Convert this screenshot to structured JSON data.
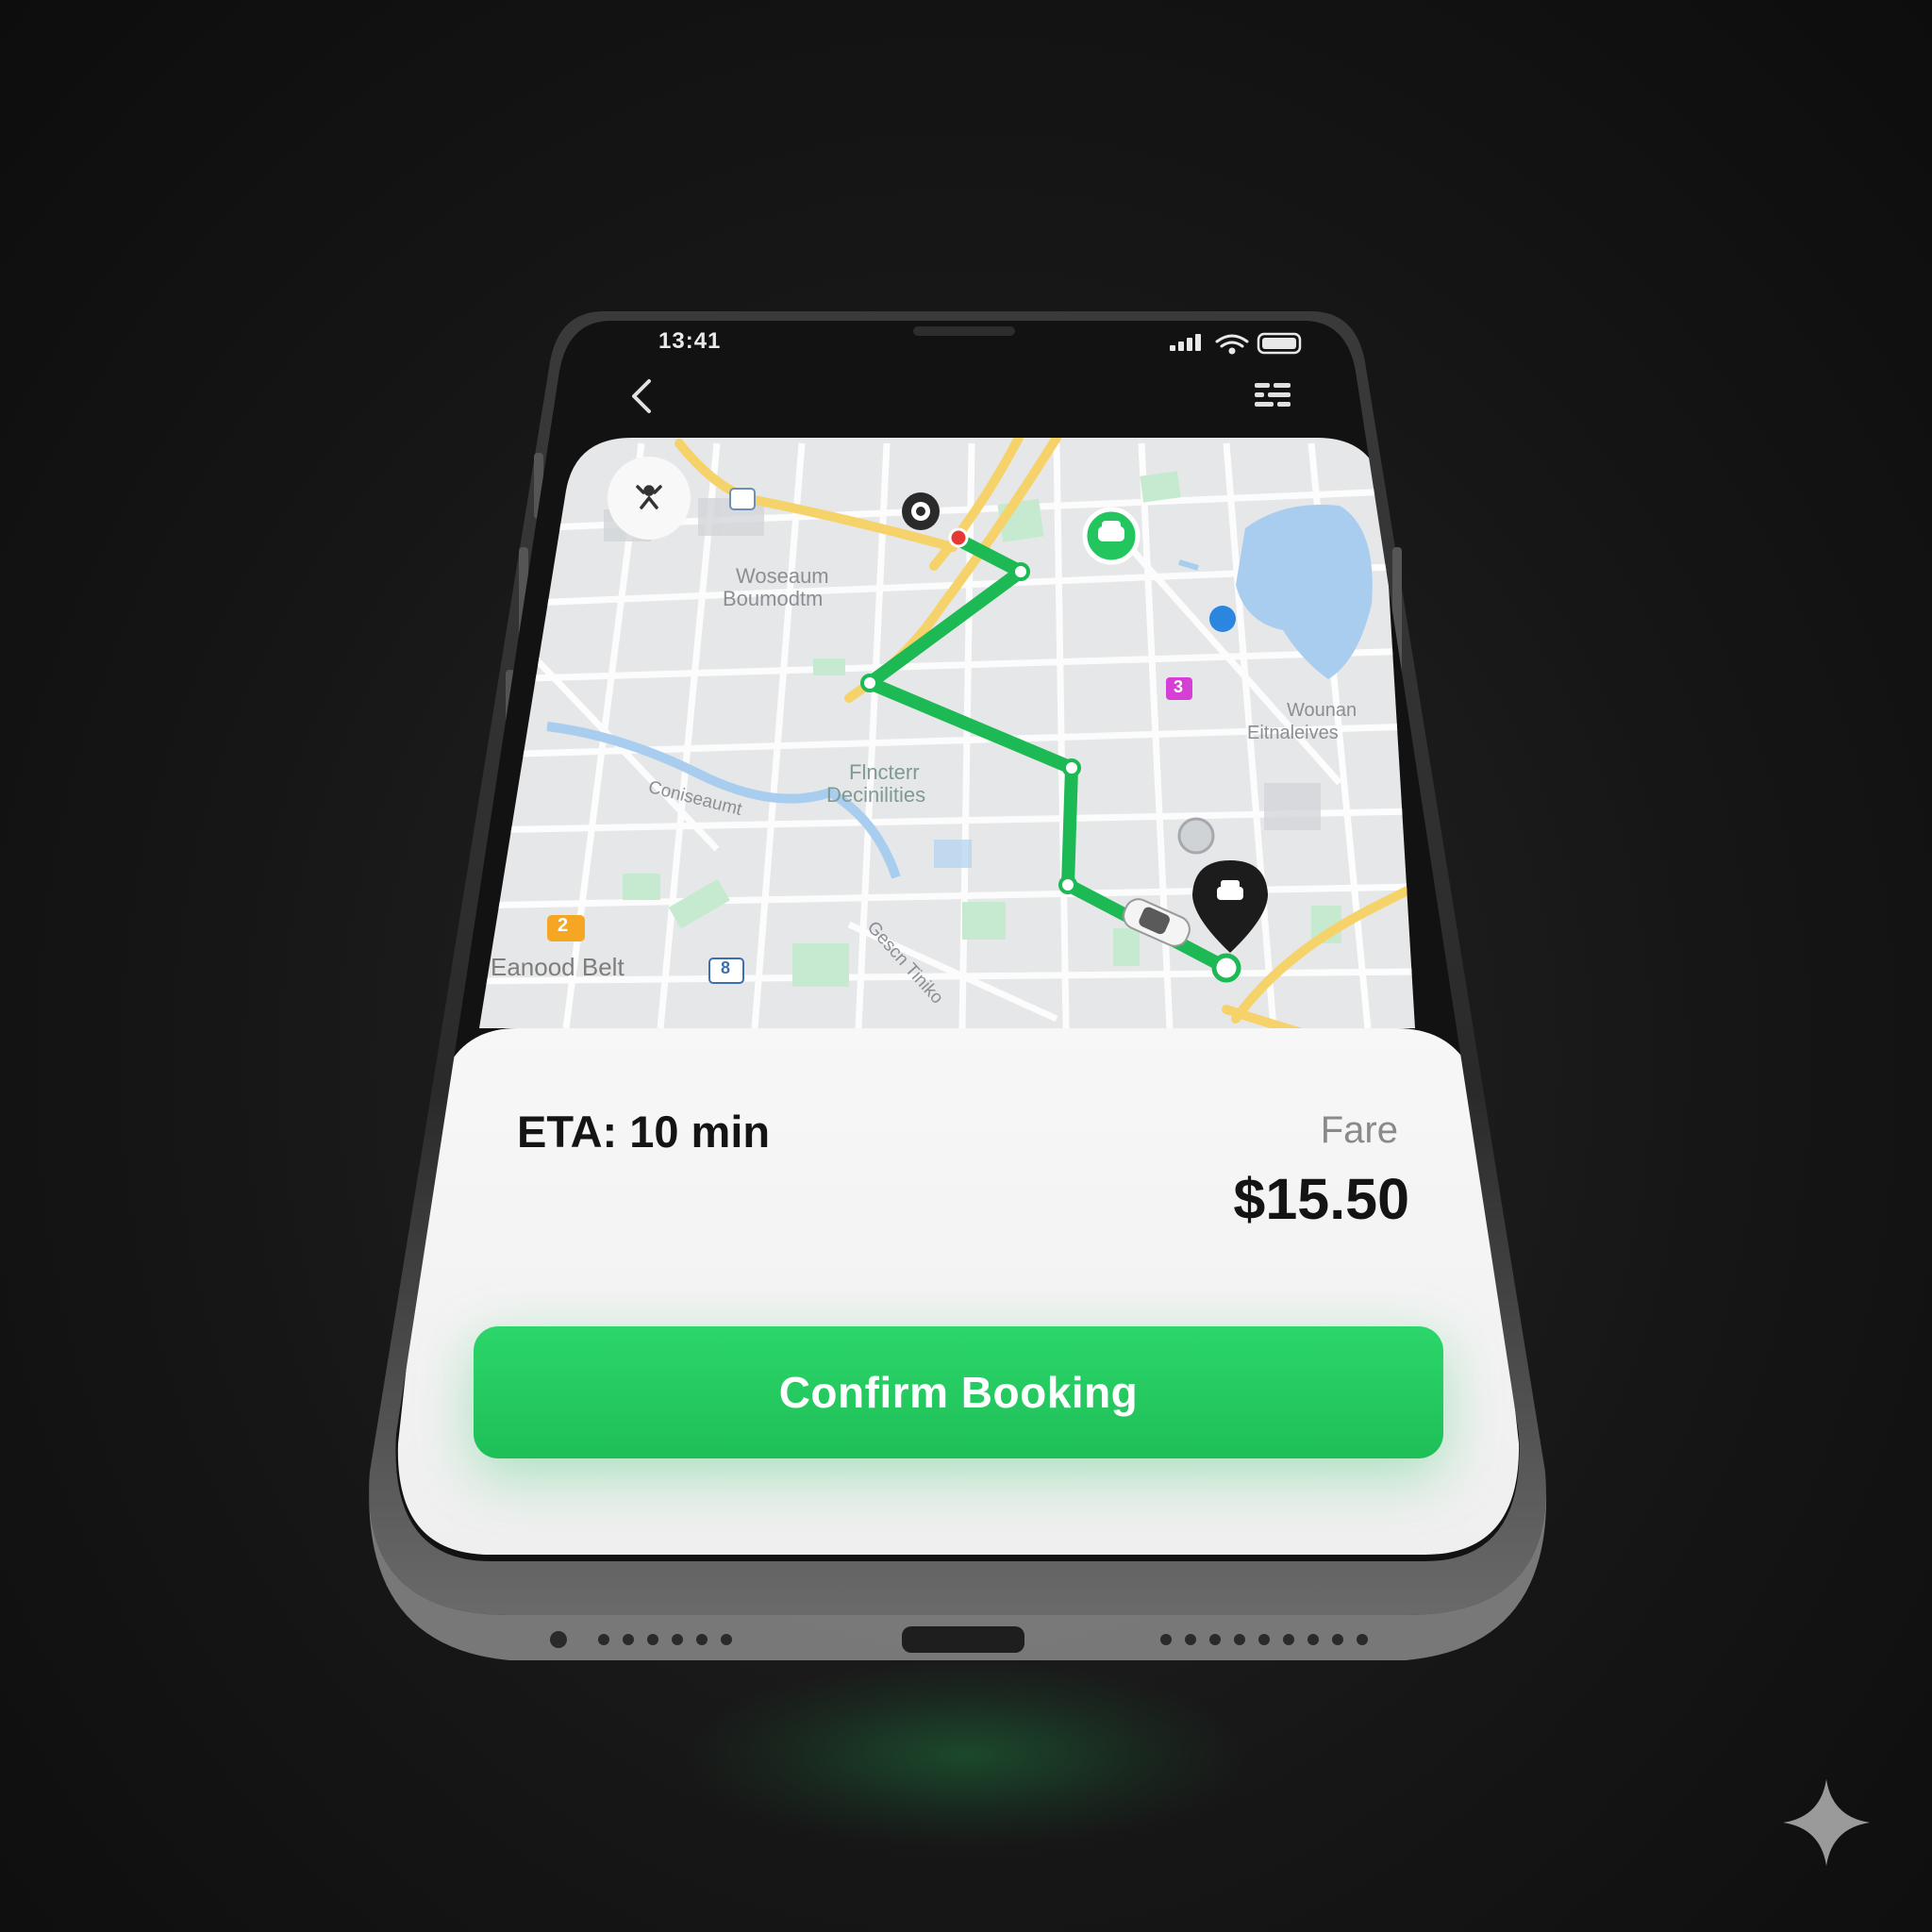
{
  "status_bar": {
    "time": "13:41",
    "icons": [
      "signal-icon",
      "wifi-icon",
      "battery-icon"
    ]
  },
  "nav_bar": {
    "back_icon": "chevron-left-icon",
    "menu_icon": "menu-grid-icon"
  },
  "map": {
    "labels": {
      "area_1": "Woseaum",
      "area_1b": "Boumodtm",
      "area_2": "Flncterr",
      "area_2b": "Decinilities",
      "area_3": "Wounan",
      "area_3b": "Eitnaleives",
      "street_1": "Coniseaumt",
      "street_2": "Eanood Belt",
      "street_3": "Gescn Tiniko",
      "badge_1": "2",
      "badge_2": "3",
      "badge_3": "8"
    },
    "markers": [
      "user-location-icon",
      "origin-pin-icon",
      "taxi-stop-icon",
      "destination-car-pin-icon",
      "car-icon"
    ],
    "route_color": "#22c55e"
  },
  "booking": {
    "eta": "ETA: 10 min",
    "fare_label": "Fare",
    "fare_value": "$15.50",
    "confirm_label": "Confirm Booking"
  },
  "colors": {
    "accent": "#22c55e",
    "map_bg": "#e6e7e8",
    "road_major": "#f6d36a",
    "water": "#a9cdee",
    "park": "#bfe6c4"
  }
}
